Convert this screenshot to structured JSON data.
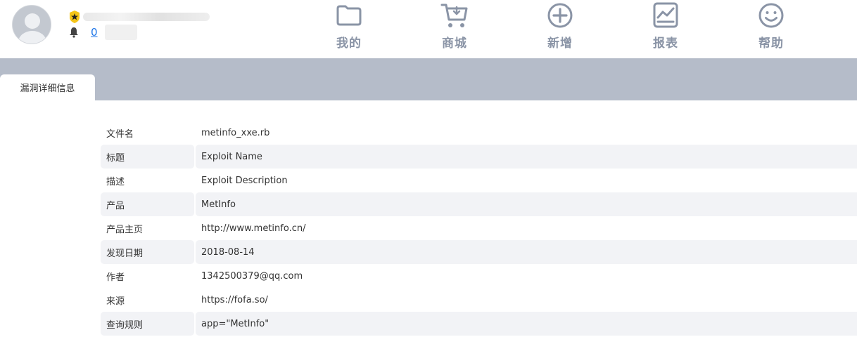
{
  "user": {
    "notification_count": "0",
    "avatar_icon": "user-avatar-icon",
    "badge_icon": "star-shield-icon",
    "bell_icon": "bell-icon"
  },
  "nav": {
    "items": [
      {
        "label": "我的",
        "icon": "folder-icon"
      },
      {
        "label": "商城",
        "icon": "cart-icon"
      },
      {
        "label": "新增",
        "icon": "plus-circle-icon"
      },
      {
        "label": "报表",
        "icon": "chart-icon"
      },
      {
        "label": "帮助",
        "icon": "smile-icon"
      }
    ]
  },
  "tabs": [
    {
      "label": "漏洞详细信息",
      "active": true
    }
  ],
  "details": [
    {
      "key": "文件名",
      "value": "metinfo_xxe.rb"
    },
    {
      "key": "标题",
      "value": "Exploit Name"
    },
    {
      "key": "描述",
      "value": "Exploit Description"
    },
    {
      "key": "产品",
      "value": "MetInfo"
    },
    {
      "key": "产品主页",
      "value": "http://www.metinfo.cn/"
    },
    {
      "key": "发现日期",
      "value": "2018-08-14"
    },
    {
      "key": "作者",
      "value": "1342500379@qq.com"
    },
    {
      "key": "来源",
      "value": "https://fofa.so/"
    },
    {
      "key": "查询规则",
      "value": "app=\"MetInfo\""
    }
  ],
  "colors": {
    "nav_icon": "#8a94a6",
    "tab_strip": "#b5bcc9",
    "row_alt": "#f2f3f6",
    "link": "#1a73e8",
    "badge": "#f5c518"
  }
}
